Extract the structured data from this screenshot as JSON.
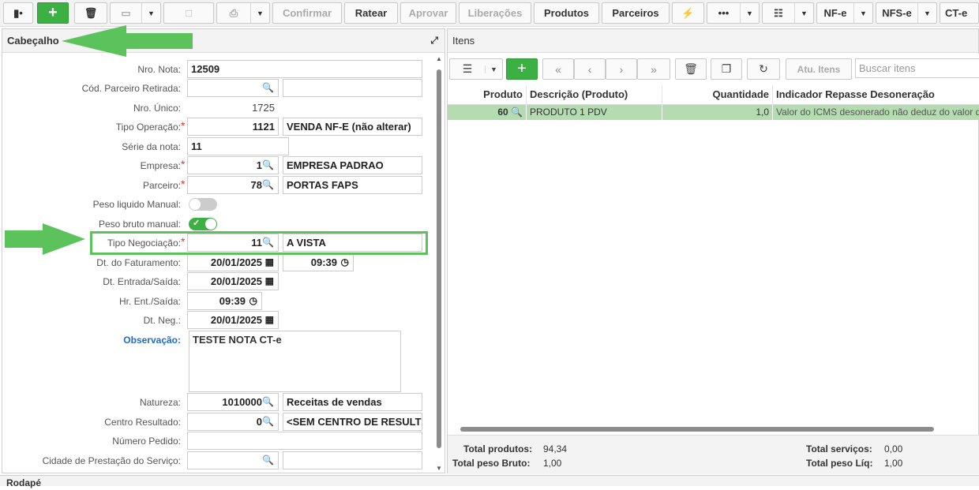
{
  "toolbar": {
    "confirm": "Confirmar",
    "ratear": "Ratear",
    "aprovar": "Aprovar",
    "liberacoes": "Liberações",
    "produtos": "Produtos",
    "parceiros": "Parceiros",
    "nfe": "NF-e",
    "nfse": "NFS-e",
    "cte": "CT-e"
  },
  "header": {
    "title": "Cabeçalho"
  },
  "form": {
    "nro_nota": {
      "label": "Nro. Nota:",
      "value": "12509"
    },
    "cod_parceiro_retirada": {
      "label": "Cód. Parceiro Retirada:"
    },
    "nro_unico": {
      "label": "Nro. Único:",
      "value": "1725"
    },
    "tipo_operacao": {
      "label": "Tipo Operação:",
      "code": "1121",
      "desc": "VENDA NF-E (não alterar)"
    },
    "serie": {
      "label": "Série da nota:",
      "value": "11"
    },
    "empresa": {
      "label": "Empresa:",
      "code": "1",
      "desc": "EMPRESA PADRAO"
    },
    "parceiro": {
      "label": "Parceiro:",
      "code": "78",
      "desc": "PORTAS FAPS"
    },
    "peso_liquido": {
      "label": "Peso liquido Manual:",
      "on": false
    },
    "peso_bruto": {
      "label": "Peso bruto manual:",
      "on": true
    },
    "tipo_negociacao": {
      "label": "Tipo Negociação:",
      "code": "11",
      "desc": "A VISTA"
    },
    "dt_faturamento": {
      "label": "Dt. do Faturamento:",
      "date": "20/01/2025",
      "time": "09:39"
    },
    "dt_entrada_saida": {
      "label": "Dt. Entrada/Saída:",
      "date": "20/01/2025"
    },
    "hr_ent_saida": {
      "label": "Hr. Ent./Saída:",
      "time": "09:39"
    },
    "dt_neg": {
      "label": "Dt. Neg.:",
      "date": "20/01/2025"
    },
    "observacao": {
      "label": "Observação:",
      "value": "TESTE NOTA CT-e"
    },
    "natureza": {
      "label": "Natureza:",
      "code": "1010000",
      "desc": "Receitas de vendas"
    },
    "centro_resultado": {
      "label": "Centro Resultado:",
      "code": "0",
      "desc": "<SEM CENTRO DE RESULT"
    },
    "numero_pedido": {
      "label": "Número Pedido:"
    },
    "cidade_prestacao": {
      "label": "Cidade de Prestação do Serviço:"
    }
  },
  "items": {
    "title": "Itens",
    "atu_itens": "Atu. Itens",
    "search_placeholder": "Buscar itens",
    "columns": [
      "Produto",
      "Descrição (Produto)",
      "Quantidade",
      "Indicador Repasse Desoneração"
    ],
    "rows": [
      {
        "produto": "60",
        "descricao": "PRODUTO 1 PDV",
        "quantidade": "1,0",
        "indicador": "Valor do ICMS desonerado não deduz do valor da"
      }
    ]
  },
  "totals": {
    "total_produtos_label": "Total produtos:",
    "total_produtos": "94,34",
    "total_peso_bruto_label": "Total peso Bruto:",
    "total_peso_bruto": "1,00",
    "total_servicos_label": "Total serviços:",
    "total_servicos": "0,00",
    "total_peso_liq_label": "Total peso Líq:",
    "total_peso_liq": "1,00"
  },
  "footer": {
    "title": "Rodapé"
  },
  "colors": {
    "accent_green": "#3cb043",
    "row_highlight": "#b5dbb0",
    "annotation_green": "#5cc35c"
  }
}
